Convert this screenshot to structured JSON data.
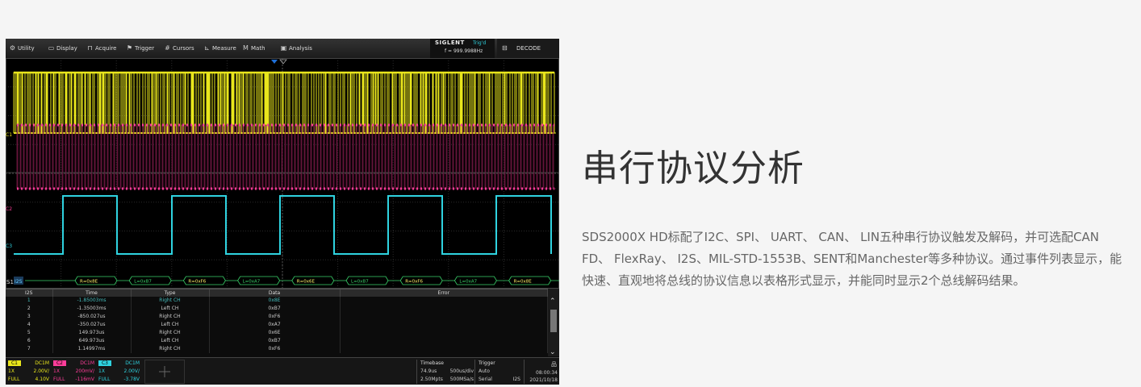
{
  "menu": {
    "items": [
      {
        "label": "Utility",
        "icon": "gear-icon",
        "glyph": "⚙"
      },
      {
        "label": "Display",
        "icon": "monitor-icon",
        "glyph": "▭"
      },
      {
        "label": "Acquire",
        "icon": "acquire-icon",
        "glyph": "⊓"
      },
      {
        "label": "Trigger",
        "icon": "flag-icon",
        "glyph": "⚑"
      },
      {
        "label": "Cursors",
        "icon": "cursors-icon",
        "glyph": "#"
      },
      {
        "label": "Measure",
        "icon": "measure-icon",
        "glyph": "⊾"
      },
      {
        "label": "Math",
        "icon": "math-icon",
        "glyph": "M"
      },
      {
        "label": "Analysis",
        "icon": "analysis-icon",
        "glyph": "▣"
      }
    ],
    "brand": "SIGLENT",
    "trig_state": "Trig'd",
    "frequency": "f = 999.9988Hz",
    "decode": "DECODE",
    "decode_glyph": "⊟"
  },
  "channel_markers": {
    "c1": "C1",
    "c2": "C2",
    "c3": "C3",
    "s1": "S1",
    "bus": "I2S"
  },
  "decode_frames": [
    "R=0x8E",
    "L=0xB7",
    "R=0xF6",
    "L=0xA7",
    "R=0x6E",
    "L=0xB7",
    "R=0xF6",
    "L=0xA7",
    "R=0x8E"
  ],
  "table": {
    "headers": [
      "I2S",
      "Time",
      "Type",
      "Data",
      "Error"
    ],
    "rows": [
      [
        "1",
        "-1.85003ms",
        "Right CH",
        "0x8E",
        ""
      ],
      [
        "2",
        "-1.35003ms",
        "Left CH",
        "0xB7",
        ""
      ],
      [
        "3",
        "-850.027us",
        "Right CH",
        "0xF6",
        ""
      ],
      [
        "4",
        "-350.027us",
        "Left CH",
        "0xA7",
        ""
      ],
      [
        "5",
        "149.973us",
        "Right CH",
        "0x6E",
        ""
      ],
      [
        "6",
        "649.973us",
        "Left CH",
        "0xB7",
        ""
      ],
      [
        "7",
        "1.14997ms",
        "Right CH",
        "0xF6",
        ""
      ]
    ],
    "scroll_up": "⌃",
    "scroll_down": "⌄"
  },
  "status": {
    "c1": {
      "tag": "C1",
      "coupling": "DC1M",
      "probe": "1X",
      "scale": "2.00V/",
      "bw": "FULL",
      "offset": "4.10V"
    },
    "c2": {
      "tag": "C2",
      "coupling": "DC1M",
      "probe": "1X",
      "scale": "200mV/",
      "bw": "FULL",
      "offset": "-116mV"
    },
    "c3": {
      "tag": "C3",
      "coupling": "DC1M",
      "probe": "1X",
      "scale": "2.00V/",
      "bw": "FULL",
      "offset": "-3.78V"
    },
    "timebase": {
      "header": "Timebase",
      "delay": "74.9us",
      "scale": "500us/div",
      "points": "2.50Mpts",
      "rate": "500MSa/s"
    },
    "trigger": {
      "header": "Trigger",
      "mode": "Auto",
      "type": "Serial",
      "source": "I2S"
    },
    "time": "08:00:34",
    "date": "2021/10/18",
    "lan_glyph": "品"
  },
  "colors": {
    "c1": "#e9e61c",
    "c2": "#ff3d9a",
    "c3": "#2fd3e0",
    "decode": "#3ad26a"
  },
  "heading": "串行协议分析",
  "description": "SDS2000X HD标配了I2C、SPI、 UART、 CAN、 LIN五种串行协议触发及解码，并可选配CAN FD、 FlexRay、 I2S、MIL-STD-1553B、SENT和Manchester等多种协议。通过事件列表显示，能快速、直观地将总线的协议信息以表格形式显示，并能同时显示2个总线解码结果。"
}
